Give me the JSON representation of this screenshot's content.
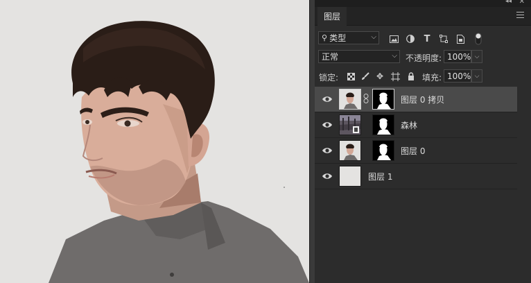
{
  "panel": {
    "tab_label": "图层"
  },
  "filter_row": {
    "kind_label": "类型",
    "icons": [
      "image-filter-icon",
      "adjustment-filter-icon",
      "type-filter-icon",
      "shape-filter-icon",
      "smart-object-filter-icon",
      "filter-toggle-switch"
    ]
  },
  "blend_row": {
    "blend_mode": "正常",
    "opacity_label": "不透明度:",
    "opacity_value": "100%"
  },
  "lock_row": {
    "lock_label": "锁定:",
    "fill_label": "填充:",
    "fill_value": "100%",
    "icons": [
      "lock-transparent-pixels-icon",
      "lock-image-pixels-icon",
      "lock-position-icon",
      "artboard-lock-icon",
      "lock-all-icon"
    ]
  },
  "layers": [
    {
      "name": "图层 0 拷贝",
      "selected": true,
      "has_mask": true,
      "thumb": "portrait"
    },
    {
      "name": "森林",
      "selected": false,
      "has_mask": true,
      "thumb": "forest"
    },
    {
      "name": "图层 0",
      "selected": false,
      "has_mask": true,
      "thumb": "portrait"
    },
    {
      "name": "图层 1",
      "selected": false,
      "has_mask": false,
      "thumb": "solid"
    }
  ],
  "colors": {
    "canvas_bg": "#e4e3e1",
    "panel_bg": "#2c2c2c",
    "selected_layer": "#4a4a4a"
  }
}
